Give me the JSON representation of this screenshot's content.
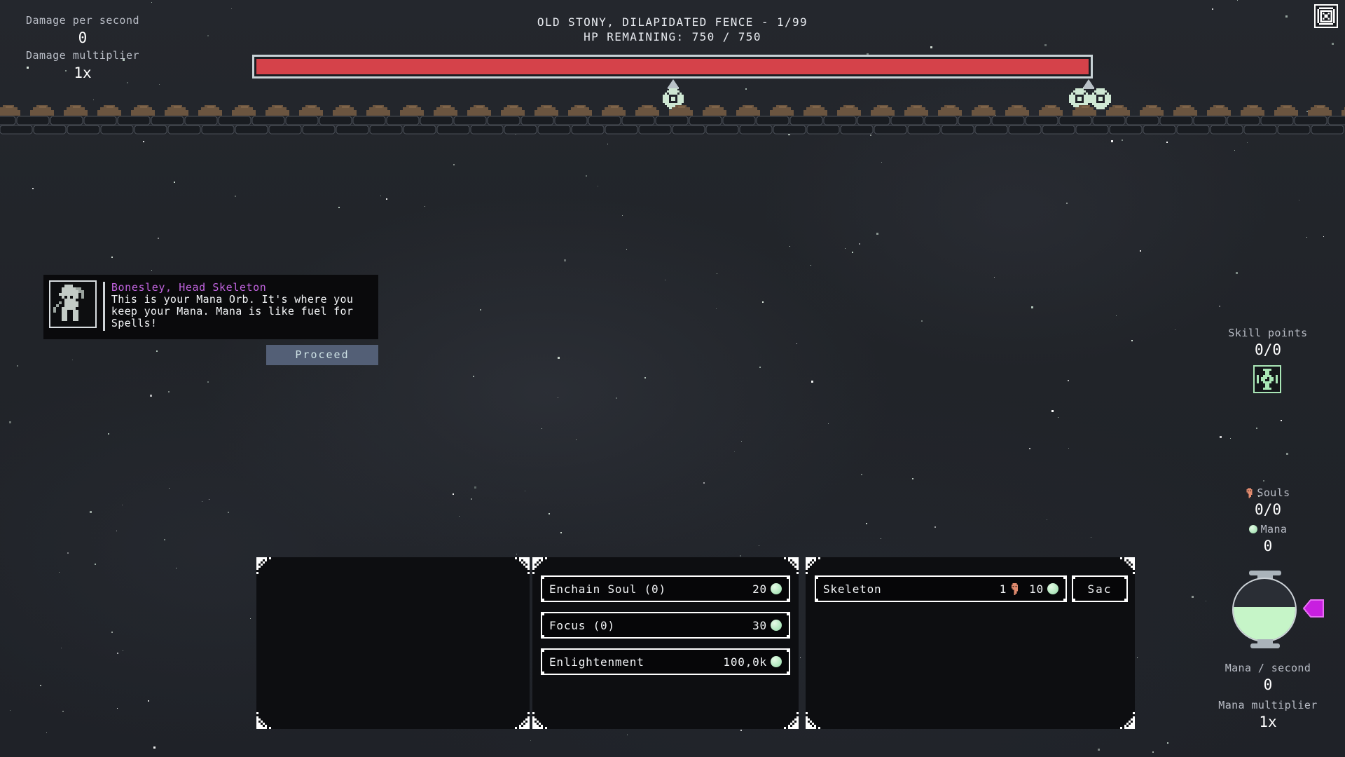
{
  "theme": {
    "bg": "#23262c",
    "hp_fill": "#d5424a",
    "hp_border": "#c8d2d6",
    "mana_green": "#c6f5c8",
    "soul_orange": "#e08a6e",
    "speaker_purple": "#c264e0",
    "button_slate": "#535f76",
    "skill_green": "#a9e6b6",
    "pointer_magenta": "#c81fe0",
    "fence_brown": "#6b5540"
  },
  "hud_left": {
    "dps_label": "Damage per second",
    "dps_value": "0",
    "damage_multiplier_label": "Damage multiplier",
    "damage_multiplier_value": "1x"
  },
  "enemy": {
    "name_line": "OLD STONY, DILAPIDATED FENCE - 1/99",
    "hp_line": "HP REMAINING: 750 / 750",
    "hp_current": 750,
    "hp_max": 750,
    "hp_percent": 100,
    "wave": 1,
    "wave_max": 99
  },
  "dialog": {
    "portrait_icon": "skeleton-portrait-icon",
    "speaker": "Bonesley, Head Skeleton",
    "body": "This is your Mana Orb. It's where you keep your Mana. Mana is like fuel for Spells!",
    "proceed_label": "Proceed"
  },
  "panels": {
    "left_panel_empty": true,
    "spells": [
      {
        "name": "Enchain Soul (0)",
        "cost": "20",
        "cost_icon": "mana-orb-icon"
      },
      {
        "name": "Focus (0)",
        "cost": "30",
        "cost_icon": "mana-orb-icon"
      },
      {
        "name": "Enlightenment",
        "cost": "100,0k",
        "cost_icon": "mana-orb-icon"
      }
    ],
    "minions": [
      {
        "name": "Skeleton",
        "soul_cost": "1",
        "soul_icon": "soul-icon",
        "mana_cost": "10",
        "mana_icon": "mana-orb-icon",
        "sac_label": "Sac"
      }
    ]
  },
  "hud_right": {
    "skill_points_label": "Skill points",
    "skill_points_value": "0/0",
    "skill_tree_icon": "skill-tree-icon",
    "souls_label": "Souls",
    "souls_icon": "soul-icon",
    "souls_value": "0/0",
    "mana_label": "Mana",
    "mana_icon": "mana-orb-icon",
    "mana_value": "0",
    "mana_per_second_label": "Mana / second",
    "mana_per_second_value": "0",
    "mana_multiplier_label": "Mana multiplier",
    "mana_multiplier_value": "1x",
    "orb_fill_percent": 55,
    "orb_pointer_icon": "magenta-pointer-icon"
  },
  "top_right": {
    "menu_icon": "achievements-icon"
  },
  "markers": [
    {
      "icon": "grave-cross-icon",
      "count": 1
    },
    {
      "icon": "grave-cross-icon",
      "count": 2
    }
  ]
}
